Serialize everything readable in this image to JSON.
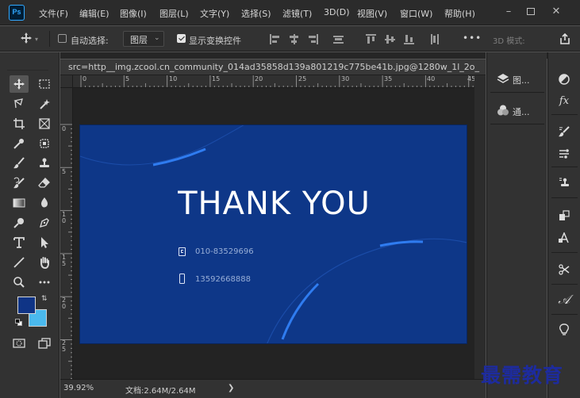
{
  "menu": {
    "items": [
      "文件(F)",
      "编辑(E)",
      "图像(I)",
      "图层(L)",
      "文字(Y)",
      "选择(S)",
      "滤镜(T)",
      "3D(D)",
      "视图(V)",
      "窗口(W)",
      "帮助(H)"
    ]
  },
  "app_logo": "Ps",
  "options": {
    "auto_select_label": "自动选择:",
    "auto_select_checked": false,
    "layer_target": "图层",
    "show_transform_label": "显示变换控件",
    "show_transform_checked": true,
    "more_label": "•••",
    "mode_3d_label": "3D 模式:"
  },
  "document": {
    "tab_title": "src=http__img.zcool.cn_community_014ad35858d139a801219c775be41b.jpg@1280w_1l_2o_",
    "heading": "THANK YOU",
    "phone": "010-83529696",
    "mobile": "13592668888",
    "background_color": "#0e3788"
  },
  "rulers": {
    "top_ticks": [
      "0",
      "5",
      "10",
      "15",
      "20",
      "25",
      "30",
      "35",
      "40",
      "45"
    ],
    "left_ticks": [
      "0",
      "5",
      "1\n0",
      "1\n5",
      "2\n0",
      "2\n5"
    ]
  },
  "status": {
    "zoom": "39.92%",
    "doc_info": "文档:2.64M/2.64M"
  },
  "panels": {
    "layers_label": "图...",
    "channels_label": "通..."
  },
  "watermark": "最需教育"
}
